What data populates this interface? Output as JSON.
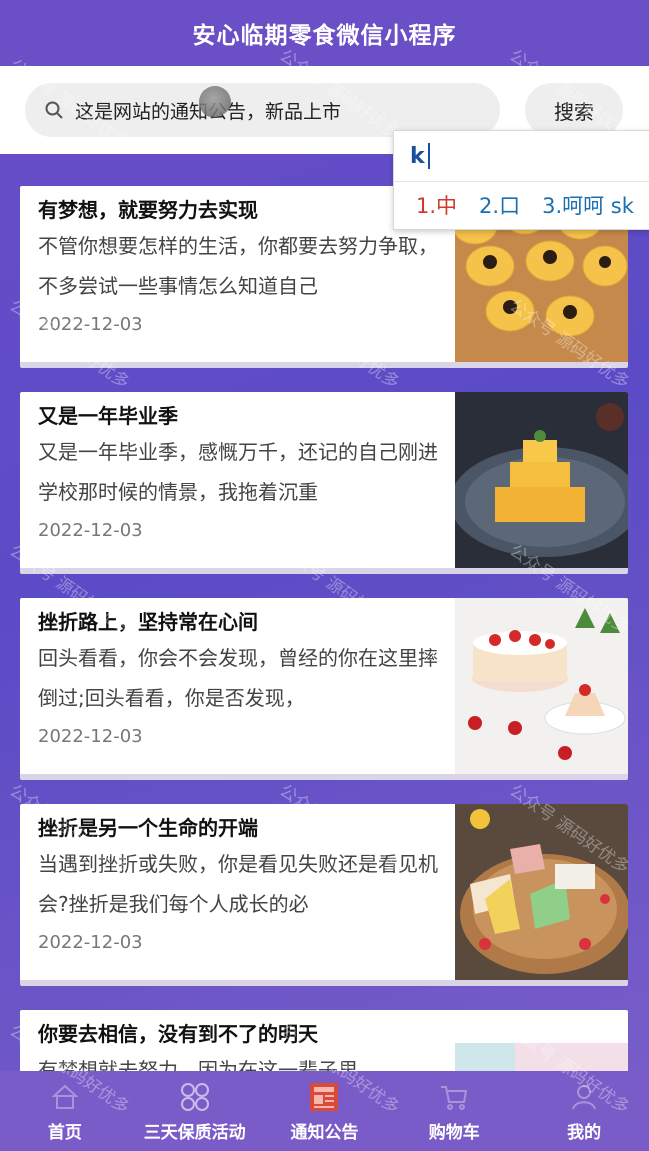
{
  "header": {
    "title": "安心临期零食微信小程序"
  },
  "search": {
    "value": "这是网站的通知公告，新品上市",
    "button_label": "搜索"
  },
  "ime": {
    "composition": "k",
    "candidates": [
      "1.中",
      "2.口",
      "3.呵呵 sk"
    ]
  },
  "articles": [
    {
      "title": "有梦想，就要努力去实现",
      "desc": "不管你想要怎样的生活，你都要去努力争取，不多尝试一些事情怎么知道自己",
      "date": "2022-12-03"
    },
    {
      "title": "又是一年毕业季",
      "desc": "又是一年毕业季，感慨万千，还记的自己刚进学校那时候的情景，我拖着沉重",
      "date": "2022-12-03"
    },
    {
      "title": "挫折路上，坚持常在心间",
      "desc": "回头看看，你会不会发现，曾经的你在这里摔倒过;回头看看，你是否发现，",
      "date": "2022-12-03"
    },
    {
      "title": "挫折是另一个生命的开端",
      "desc": "当遇到挫折或失败，你是看见失败还是看见机会?挫折是我们每个人成长的必",
      "date": "2022-12-03"
    },
    {
      "title": "你要去相信，没有到不了的明天",
      "desc": "有梦想就去努力，因为在这一辈子里",
      "date": ""
    }
  ],
  "tabbar": [
    {
      "label": "首页",
      "icon": "home-icon"
    },
    {
      "label": "三天保质活动",
      "icon": "grid-icon"
    },
    {
      "label": "通知公告",
      "icon": "notice-icon"
    },
    {
      "label": "购物车",
      "icon": "cart-icon"
    },
    {
      "label": "我的",
      "icon": "user-icon"
    }
  ],
  "watermark": "公众号 源码好优多",
  "colors": {
    "header": "#6b4fc6",
    "tabbar": "#7a5cc9",
    "active_tab_icon": "#d94a3a"
  }
}
